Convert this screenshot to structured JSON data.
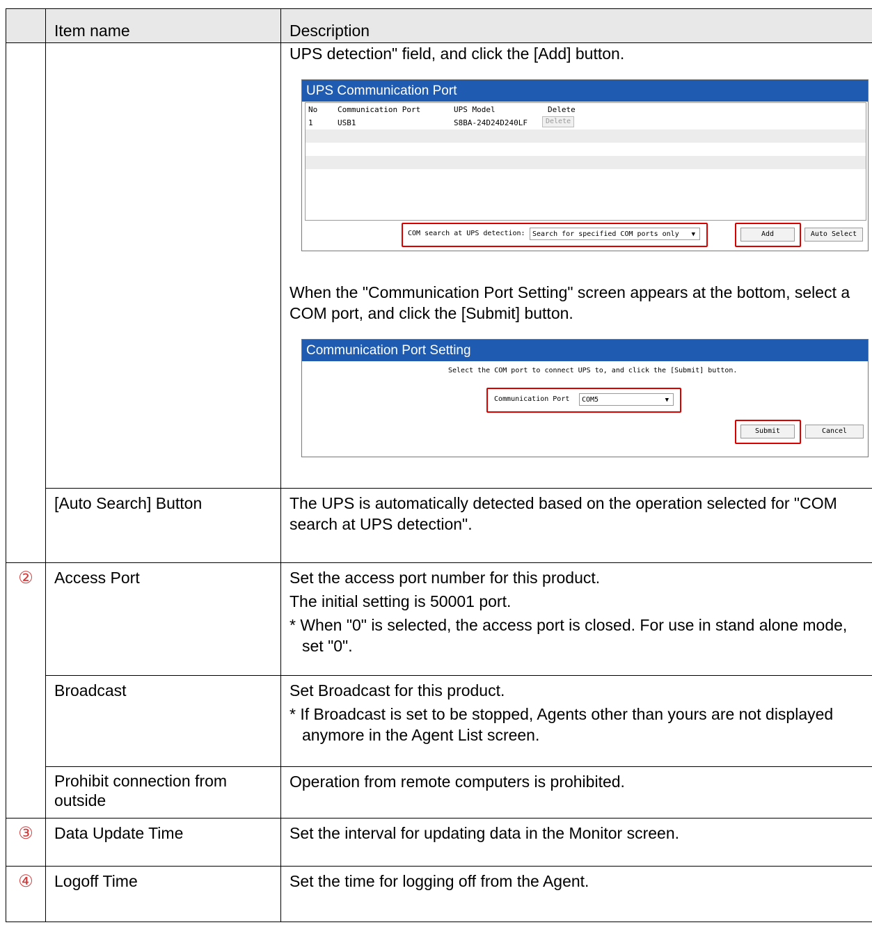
{
  "header": {
    "item_name": "Item name",
    "description": "Description"
  },
  "row_add": {
    "text1": "UPS detection\" field, and click the [Add] button.",
    "shot1": {
      "title": "UPS Communication Port",
      "col_no": "No",
      "col_port": "Communication Port",
      "col_model": "UPS Model",
      "col_delete": "Delete",
      "row_no": "1",
      "row_port": "USB1",
      "row_model": "S8BA-24D24D240LF",
      "row_delete": "Delete",
      "com_search_label": "COM search at UPS detection:",
      "com_search_value": "Search for specified COM ports only",
      "add_button": "Add",
      "auto_select_button": "Auto Select"
    },
    "text2": "When the \"Communication Port Setting\" screen appears at the bottom, select a COM port, and click the [Submit] button.",
    "shot2": {
      "title": "Communication Port Setting",
      "instruction": "Select the COM port to connect UPS to, and click the [Submit] button.",
      "port_label": "Communication Port",
      "port_value": "COM5",
      "submit_button": "Submit",
      "cancel_button": "Cancel"
    }
  },
  "rows": [
    {
      "mark": "",
      "item": "[Auto Search] Button",
      "desc": [
        "The UPS is automatically detected based on the operation selected for \"COM search at UPS detection\"."
      ]
    },
    {
      "mark": "②",
      "item": "Access Port",
      "desc": [
        "Set the access port number for this product.",
        "The initial setting is 50001 port."
      ],
      "note": "* When \"0\" is selected, the access port is closed. For use in stand alone mode, set \"0\"."
    },
    {
      "mark": "",
      "item": "Broadcast",
      "desc": [
        "Set Broadcast for this product."
      ],
      "note": "* If Broadcast is set to be stopped, Agents other than yours are not displayed anymore in the Agent List screen."
    },
    {
      "mark": "",
      "item": "Prohibit connection from outside",
      "desc": [
        "Operation from remote computers is prohibited."
      ]
    },
    {
      "mark": "③",
      "item": "Data Update Time",
      "desc": [
        "Set the interval for updating data in the Monitor screen."
      ]
    },
    {
      "mark": "④",
      "item": "Logoff Time",
      "desc": [
        "Set the time for logging off from the Agent."
      ]
    }
  ],
  "colors": {
    "title_bar": "#1f5bb0",
    "highlight": "#d90000",
    "circle_number": "#d23a3a"
  }
}
